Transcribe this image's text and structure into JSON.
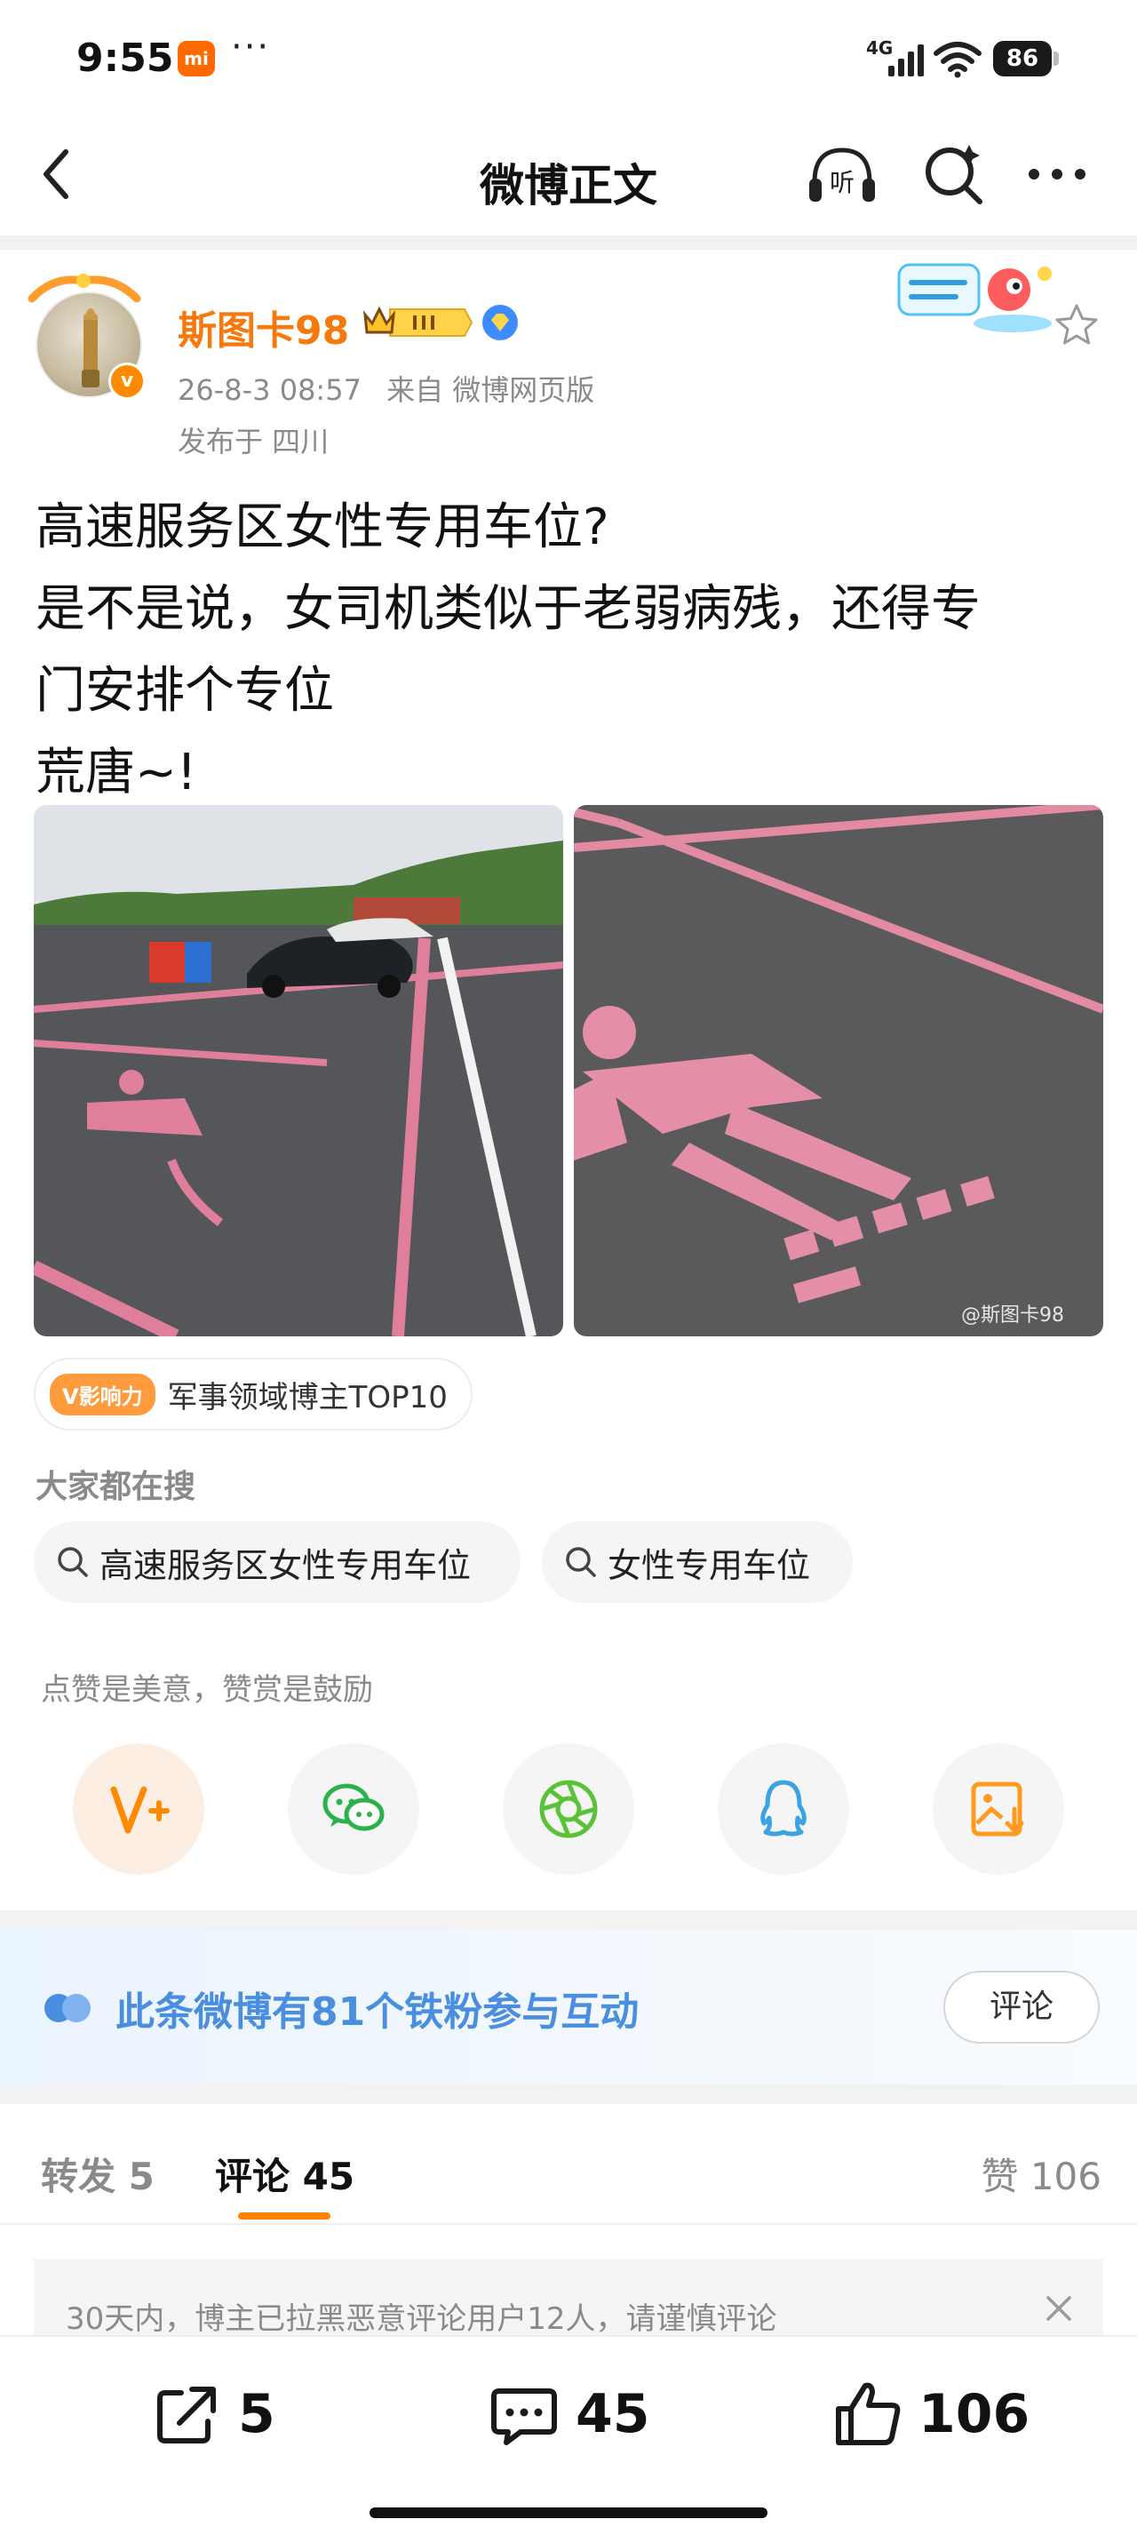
{
  "status_bar": {
    "time": "9:55",
    "carrier_badge": "mi",
    "dots": "···",
    "network": "4G",
    "battery": "86"
  },
  "nav": {
    "title": "微博正文"
  },
  "post": {
    "author": "斯图卡98",
    "date": "26-8-3 08:57",
    "source": "来自 微博网页版",
    "location": "发布于 四川",
    "text_lines": [
      "高速服务区女性专用车位?",
      "是不是说，女司机类似于老弱病残，还得专",
      "门安排个专位",
      "荒唐~!"
    ],
    "image_watermark": "@斯图卡98",
    "influence_tag": "V影响力",
    "influence_text": "军事领域博主TOP10"
  },
  "search": {
    "heading": "大家都在搜",
    "chips": [
      "高速服务区女性专用车位",
      "女性专用车位"
    ]
  },
  "reward": {
    "motto": "点赞是美意，赞赏是鼓励"
  },
  "fans_banner": {
    "text": "此条微博有81个铁粉参与互动",
    "button": "评论"
  },
  "tabs": {
    "repost": "转发 5",
    "comment": "评论 45",
    "like": "赞 106"
  },
  "notice": {
    "text": "30天内，博主已拉黑恶意评论用户12人，请谨慎评论"
  },
  "bottom_bar": {
    "share_count": "5",
    "comment_count": "45",
    "like_count": "106"
  },
  "colors": {
    "accent": "#ff8200",
    "author_name": "#f7780c",
    "link_blue": "#4a8ee0"
  }
}
